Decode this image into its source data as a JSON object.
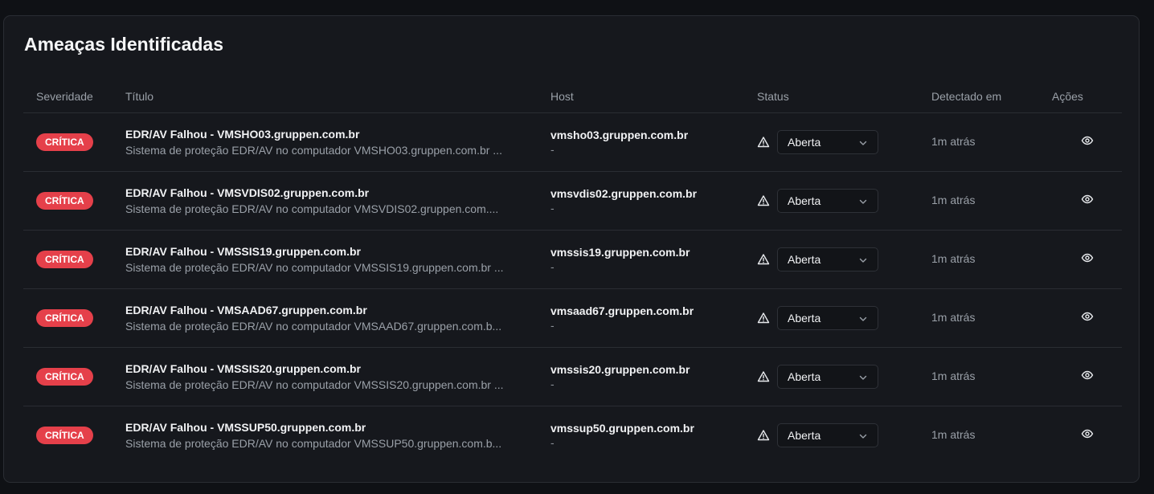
{
  "panel": {
    "title": "Ameaças Identificadas"
  },
  "table": {
    "headers": {
      "severity": "Severidade",
      "title": "Título",
      "host": "Host",
      "status": "Status",
      "detected": "Detectado em",
      "actions": "Ações"
    },
    "rows": [
      {
        "severity": "CRÍTICA",
        "title": "EDR/AV Falhou - VMSHO03.gruppen.com.br",
        "description": "Sistema de proteção EDR/AV no computador VMSHO03.gruppen.com.br ...",
        "host": "vmsho03.gruppen.com.br",
        "host_sub": "-",
        "status": "Aberta",
        "detected": "1m atrás"
      },
      {
        "severity": "CRÍTICA",
        "title": "EDR/AV Falhou - VMSVDIS02.gruppen.com.br",
        "description": "Sistema de proteção EDR/AV no computador VMSVDIS02.gruppen.com....",
        "host": "vmsvdis02.gruppen.com.br",
        "host_sub": "-",
        "status": "Aberta",
        "detected": "1m atrás"
      },
      {
        "severity": "CRÍTICA",
        "title": "EDR/AV Falhou - VMSSIS19.gruppen.com.br",
        "description": "Sistema de proteção EDR/AV no computador VMSSIS19.gruppen.com.br ...",
        "host": "vmssis19.gruppen.com.br",
        "host_sub": "-",
        "status": "Aberta",
        "detected": "1m atrás"
      },
      {
        "severity": "CRÍTICA",
        "title": "EDR/AV Falhou - VMSAAD67.gruppen.com.br",
        "description": "Sistema de proteção EDR/AV no computador VMSAAD67.gruppen.com.b...",
        "host": "vmsaad67.gruppen.com.br",
        "host_sub": "-",
        "status": "Aberta",
        "detected": "1m atrás"
      },
      {
        "severity": "CRÍTICA",
        "title": "EDR/AV Falhou - VMSSIS20.gruppen.com.br",
        "description": "Sistema de proteção EDR/AV no computador VMSSIS20.gruppen.com.br ...",
        "host": "vmssis20.gruppen.com.br",
        "host_sub": "-",
        "status": "Aberta",
        "detected": "1m atrás"
      },
      {
        "severity": "CRÍTICA",
        "title": "EDR/AV Falhou - VMSSUP50.gruppen.com.br",
        "description": "Sistema de proteção EDR/AV no computador VMSSUP50.gruppen.com.b...",
        "host": "vmssup50.gruppen.com.br",
        "host_sub": "-",
        "status": "Aberta",
        "detected": "1m atrás"
      }
    ]
  },
  "icons": {
    "status": "warning-triangle-icon",
    "select": "chevron-down-icon",
    "action": "eye-icon"
  },
  "colors": {
    "background": "#0f1115",
    "card": "#16181d",
    "critical": "#e5404a",
    "border": "#2a2d33",
    "muted_text": "#9aa0a8"
  }
}
